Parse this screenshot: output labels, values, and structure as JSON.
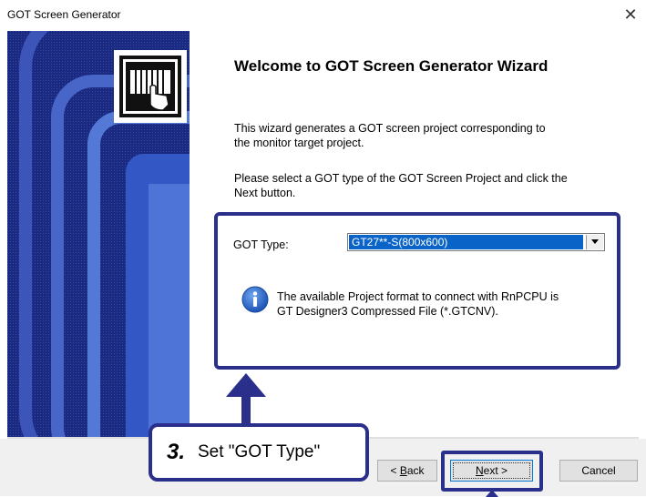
{
  "window": {
    "title": "GOT Screen Generator",
    "close_icon": "close-icon"
  },
  "content": {
    "welcome_title": "Welcome to GOT Screen Generator Wizard",
    "paragraph1_line1": "This wizard generates a GOT screen project corresponding to",
    "paragraph1_line2": "the monitor target project.",
    "paragraph2_line1": "Please select a GOT type of the GOT Screen Project and click the",
    "paragraph2_line2": "Next button."
  },
  "got_type": {
    "label": "GOT Type:",
    "selected_value": "GT27**-S(800x600)"
  },
  "info": {
    "icon": "info-icon",
    "line1": "The available Project format to connect with RnPCPU is",
    "line2": "GT Designer3 Compressed File (*.GTCNV)."
  },
  "callout": {
    "step_number": "3.",
    "step_text": "Set \"GOT Type\""
  },
  "buttons": {
    "back_prefix": "< ",
    "back_mnemonic": "B",
    "back_rest": "ack",
    "next_mnemonic": "N",
    "next_rest": "ext >",
    "cancel": "Cancel"
  },
  "colors": {
    "highlight": "#2b2f8c",
    "banner": "#1a2a80",
    "selection": "#0a64c8"
  }
}
